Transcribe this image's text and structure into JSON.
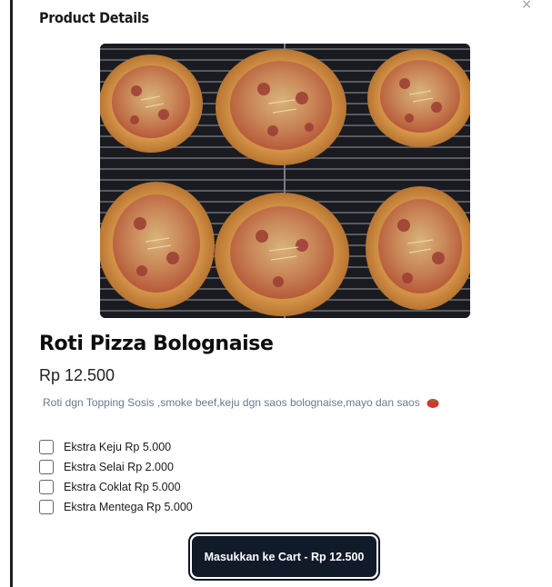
{
  "header": {
    "title": "Product Details",
    "close_icon": "close-icon"
  },
  "product": {
    "image_icon": "pizza-bread-photo",
    "name": "Roti Pizza Bolognaise",
    "price": "Rp 12.500",
    "description": "Roti dgn Topping Sosis ,smoke beef,keju dgn saos bolognaise,mayo dan saos",
    "description_icon": "tomato-icon"
  },
  "options": [
    {
      "label": "Ekstra Keju Rp 5.000",
      "checked": false
    },
    {
      "label": "Ekstra Selai Rp 2.000",
      "checked": false
    },
    {
      "label": "Ekstra Coklat Rp 5.000",
      "checked": false
    },
    {
      "label": "Ekstra Mentega Rp 5.000",
      "checked": false
    }
  ],
  "cart_button": {
    "label": "Masukkan ke Cart - Rp 12.500"
  },
  "colors": {
    "button_bg": "#111a29",
    "description_text": "#6b7a8f",
    "tomato": "#d9342b"
  }
}
